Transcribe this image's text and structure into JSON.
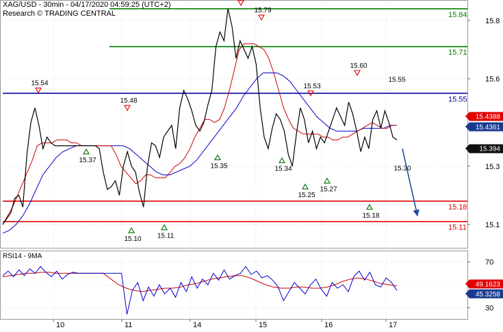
{
  "header": {
    "line1": "XAG/USD - 30min - 04/17/2020 04:59:25 (UTC+2)",
    "line2": "Research © TRADING CENTRAL"
  },
  "colors": {
    "price": "#000000",
    "sma_red": "#cc0000",
    "sma_blue": "#0000cc",
    "green_level": "#008000",
    "blue_level": "#000099",
    "red_level": "#e00000",
    "arrow": "#1f4e9a",
    "badge_red": "#e00000",
    "badge_blue": "#1a3a8f",
    "badge_dark": "#111111"
  },
  "chart_data": [
    {
      "type": "line",
      "name": "price-panel",
      "y_axis": {
        "min": 15.02,
        "max": 15.87,
        "ticks": [
          "15.1",
          "15.3",
          "15.6",
          "15.8"
        ],
        "tick_values": [
          15.1,
          15.3,
          15.6,
          15.8
        ]
      },
      "x_axis": {
        "labels": [
          "10",
          "11",
          "14",
          "15",
          "16",
          "17"
        ]
      },
      "horizontal_levels": [
        {
          "value": 15.84,
          "label": "15.84",
          "color": "green"
        },
        {
          "value": 15.71,
          "label": "15.71",
          "color": "green"
        },
        {
          "value": 15.55,
          "label": "15.55",
          "color": "blue"
        },
        {
          "value": 15.18,
          "label": "15.18",
          "color": "red"
        },
        {
          "value": 15.11,
          "label": "15.11",
          "color": "red"
        }
      ],
      "price_badges": [
        {
          "label": "15.4388",
          "value": 15.4388,
          "style": "red"
        },
        {
          "label": "15.4361",
          "value": 15.4361,
          "style": "blue"
        },
        {
          "label": "15.394",
          "value": 15.394,
          "style": "dark"
        }
      ],
      "swing_labels": [
        {
          "label": "15.54",
          "value": 15.54,
          "kind": "high"
        },
        {
          "label": "15.48",
          "value": 15.48,
          "kind": "high"
        },
        {
          "label": "15.84",
          "value": 15.84,
          "kind": "high"
        },
        {
          "label": "15.79",
          "value": 15.79,
          "kind": "high"
        },
        {
          "label": "15.53",
          "value": 15.53,
          "kind": "high"
        },
        {
          "label": "15.60",
          "value": 15.6,
          "kind": "high"
        },
        {
          "label": "15.55",
          "value": 15.55,
          "kind": "note"
        },
        {
          "label": "15.37",
          "value": 15.37,
          "kind": "low"
        },
        {
          "label": "15.10",
          "value": 15.1,
          "kind": "low"
        },
        {
          "label": "15.11",
          "value": 15.11,
          "kind": "low"
        },
        {
          "label": "15.35",
          "value": 15.35,
          "kind": "low"
        },
        {
          "label": "15.34",
          "value": 15.34,
          "kind": "low"
        },
        {
          "label": "15.25",
          "value": 15.25,
          "kind": "low"
        },
        {
          "label": "15.27",
          "value": 15.27,
          "kind": "low"
        },
        {
          "label": "15.18",
          "value": 15.18,
          "kind": "low"
        },
        {
          "label": "15.30",
          "value": 15.3,
          "kind": "note"
        }
      ],
      "price_series": [
        15.1,
        15.12,
        15.14,
        15.19,
        15.2,
        15.16,
        15.34,
        15.45,
        15.5,
        15.44,
        15.36,
        15.4,
        15.38,
        15.37,
        15.37,
        15.37,
        15.37,
        15.37,
        15.37,
        15.37,
        15.37,
        15.37,
        15.37,
        15.37,
        15.36,
        15.28,
        15.22,
        15.23,
        15.25,
        15.2,
        15.3,
        15.35,
        15.3,
        15.28,
        15.21,
        15.16,
        15.3,
        15.38,
        15.37,
        15.33,
        15.4,
        15.42,
        15.44,
        15.36,
        15.5,
        15.56,
        15.53,
        15.49,
        15.44,
        15.42,
        15.45,
        15.51,
        15.56,
        15.71,
        15.76,
        15.73,
        15.84,
        15.78,
        15.67,
        15.73,
        15.7,
        15.67,
        15.71,
        15.65,
        15.5,
        15.4,
        15.36,
        15.43,
        15.48,
        15.46,
        15.42,
        15.34,
        15.3,
        15.41,
        15.5,
        15.46,
        15.38,
        15.42,
        15.36,
        15.4,
        15.38,
        15.42,
        15.46,
        15.5,
        15.47,
        15.44,
        15.52,
        15.48,
        15.42,
        15.35,
        15.4,
        15.36,
        15.46,
        15.49,
        15.43,
        15.49,
        15.45,
        15.4,
        15.39
      ],
      "sma_red_series": [
        15.1,
        15.13,
        15.16,
        15.2,
        15.24,
        15.28,
        15.32,
        15.37,
        15.38,
        15.38,
        15.38,
        15.39,
        15.39,
        15.39,
        15.38,
        15.38,
        15.37,
        15.37,
        15.37,
        15.37,
        15.37,
        15.37,
        15.37,
        15.34,
        15.3,
        15.28,
        15.26,
        15.24,
        15.25,
        15.27,
        15.27,
        15.26,
        15.26,
        15.26,
        15.28,
        15.3,
        15.31,
        15.33,
        15.36,
        15.4,
        15.43,
        15.46,
        15.46,
        15.45,
        15.46,
        15.5,
        15.56,
        15.63,
        15.7,
        15.72,
        15.72,
        15.72,
        15.71,
        15.7,
        15.67,
        15.62,
        15.56,
        15.5,
        15.46,
        15.43,
        15.42,
        15.41,
        15.41,
        15.41,
        15.41,
        15.4,
        15.4,
        15.39,
        15.39,
        15.4,
        15.4,
        15.41,
        15.42,
        15.43,
        15.44,
        15.45,
        15.44,
        15.43,
        15.43,
        15.44,
        15.44
      ],
      "sma_blue_series": [
        15.07,
        15.08,
        15.1,
        15.13,
        15.17,
        15.22,
        15.27,
        15.3,
        15.33,
        15.35,
        15.36,
        15.37,
        15.37,
        15.37,
        15.37,
        15.37,
        15.37,
        15.37,
        15.37,
        15.36,
        15.34,
        15.32,
        15.3,
        15.28,
        15.27,
        15.27,
        15.28,
        15.29,
        15.3,
        15.32,
        15.35,
        15.38,
        15.41,
        15.44,
        15.47,
        15.5,
        15.54,
        15.57,
        15.6,
        15.62,
        15.62,
        15.62,
        15.61,
        15.59,
        15.56,
        15.53,
        15.5,
        15.47,
        15.45,
        15.43,
        15.42,
        15.42,
        15.42,
        15.42,
        15.43,
        15.43,
        15.43,
        15.43,
        15.44,
        15.44
      ]
    },
    {
      "type": "line",
      "name": "rsi-panel",
      "title": "RSI14 - 9MA",
      "y_axis": {
        "min": 20,
        "max": 80,
        "ticks": [
          "70",
          "30"
        ],
        "tick_values": [
          70,
          30
        ]
      },
      "reference_lines": [
        70,
        50,
        30
      ],
      "badges": [
        {
          "label": "49.1623",
          "value": 49.1623,
          "style": "red"
        },
        {
          "label": "45.3258",
          "value": 45.3258,
          "style": "blue"
        }
      ],
      "rsi_series": [
        58,
        62,
        57,
        63,
        58,
        64,
        60,
        66,
        61,
        57,
        62,
        55,
        59,
        61,
        60,
        60,
        60,
        60,
        60,
        60,
        60,
        60,
        60,
        24,
        45,
        52,
        36,
        48,
        40,
        50,
        42,
        47,
        39,
        52,
        44,
        57,
        47,
        55,
        50,
        60,
        54,
        63,
        55,
        58,
        60,
        66,
        59,
        62,
        56,
        58,
        54,
        48,
        36,
        44,
        52,
        47,
        42,
        50,
        55,
        46,
        40,
        52,
        47,
        50,
        44,
        57,
        62,
        54,
        61,
        50,
        48,
        56,
        52,
        45
      ],
      "rsi_ma_series": [
        57,
        58,
        59,
        60,
        60,
        61,
        61,
        60,
        60,
        60,
        60,
        60,
        60,
        60,
        55,
        50,
        47,
        45,
        44,
        45,
        46,
        47,
        47,
        48,
        50,
        51,
        53,
        55,
        56,
        57,
        58,
        58,
        56,
        53,
        50,
        48,
        47,
        47,
        48,
        48,
        47,
        47,
        48,
        50,
        53,
        55,
        56,
        55,
        53,
        51,
        50,
        49
      ]
    }
  ]
}
